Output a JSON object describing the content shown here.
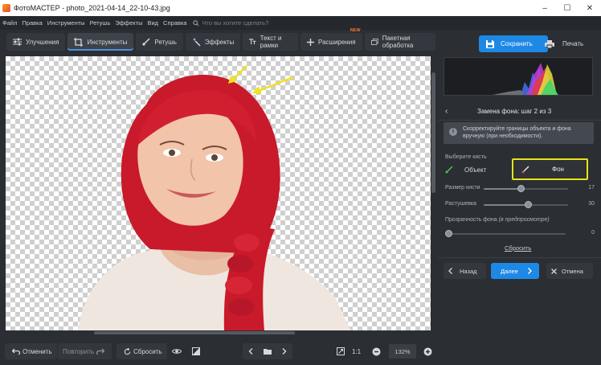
{
  "window": {
    "title": "ФотоМАСТЕР - photo_2021-04-14_22-10-43.jpg",
    "minimize": "–",
    "maximize": "☐",
    "close": "✕"
  },
  "menu": {
    "items": [
      "Файл",
      "Правка",
      "Инструменты",
      "Ретушь",
      "Эффекты",
      "Вид",
      "Справка"
    ],
    "search_placeholder": "Что вы хотите сделать?"
  },
  "toolbar": {
    "tabs": [
      {
        "label": "Улучшения",
        "icon": "sliders-icon"
      },
      {
        "label": "Инструменты",
        "icon": "crop-icon",
        "active": true
      },
      {
        "label": "Ретушь",
        "icon": "brush-icon"
      },
      {
        "label": "Эффекты",
        "icon": "magic-wand-icon"
      },
      {
        "label": "Текст и рамки",
        "icon": "text-icon"
      },
      {
        "label": "Расширения",
        "icon": "plus-icon",
        "badge": "NEW"
      },
      {
        "label": "Пакетная обработка",
        "icon": "batch-icon"
      }
    ]
  },
  "right_panel": {
    "save_label": "Сохранить",
    "print_label": "Печать",
    "step_title": "Замена фона: шаг 2 из 3",
    "info_text": "Скорректируйте границы объекта и фона вручную (при необходимости).",
    "brush_label": "Выберите кисть",
    "brush_object": "Объект",
    "brush_background": "Фон",
    "brush_size_label": "Размер кисти",
    "brush_size_value": "17",
    "feather_label": "Растушевка",
    "feather_value": "30",
    "opacity_label": "Прозрачность фона",
    "opacity_note": "(в предпросмотре)",
    "opacity_value": "0",
    "reset_label": "Сбросить",
    "back_label": "Назад",
    "next_label": "Далее",
    "cancel_label": "Отмена"
  },
  "bottom_bar": {
    "undo_label": "Отменить",
    "redo_label": "Повторить",
    "reset_label": "Сбросить",
    "ratio_label": "1:1",
    "zoom_value": "132%"
  },
  "sliders": {
    "brush_size_fraction": 0.44,
    "feather_fraction": 0.52,
    "opacity_fraction": 0.0
  },
  "colors": {
    "accent": "#1e88e5",
    "highlight": "#e8e21a",
    "panel": "#2b2e33",
    "badge": "#f07a2a"
  }
}
